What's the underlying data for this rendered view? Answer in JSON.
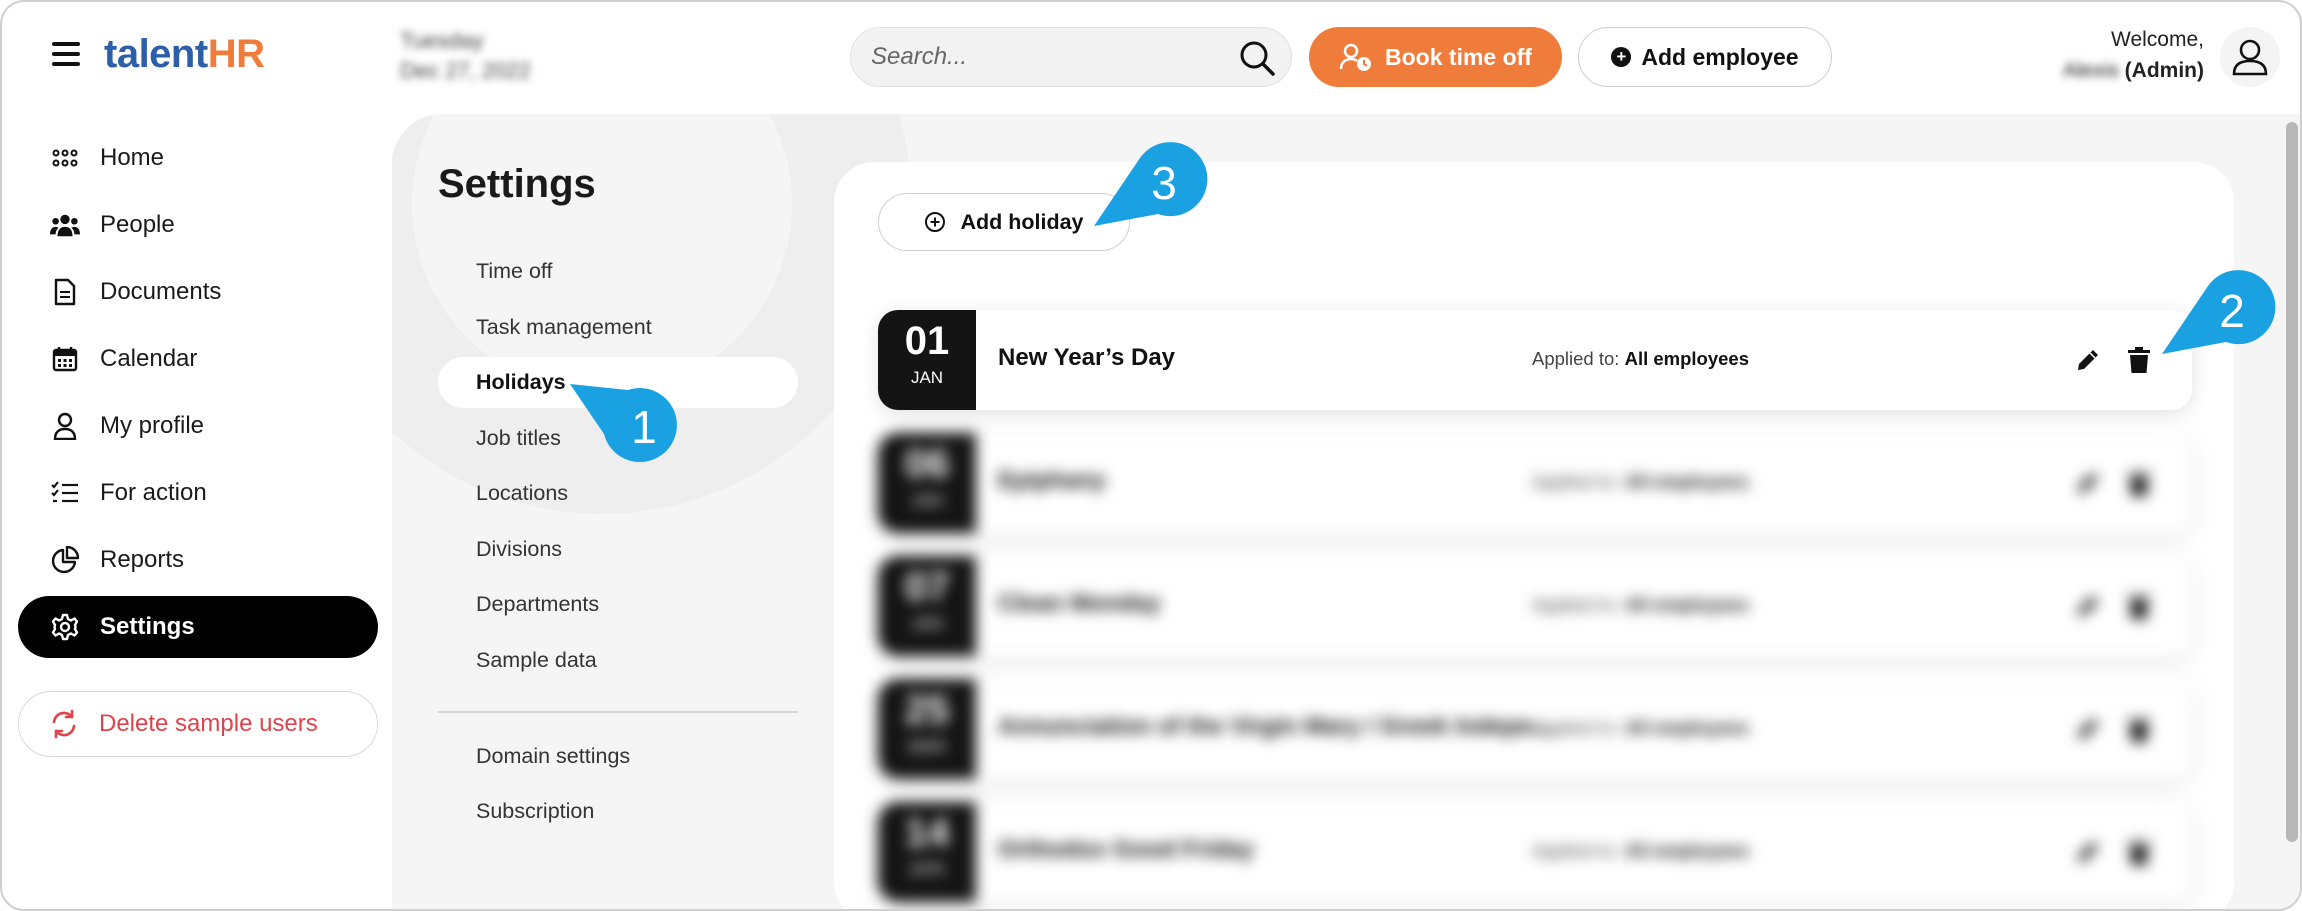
{
  "app": {
    "logo_part1": "talent",
    "logo_part2": "HR",
    "date_line1": "Tuesday",
    "date_line2": "Dec 27, 2022"
  },
  "header": {
    "search_placeholder": "Search...",
    "book_time_off": "Book time off",
    "add_employee": "Add employee",
    "welcome": "Welcome,",
    "user_name": "Alexis",
    "user_role": "(Admin)"
  },
  "sidebar": {
    "items": [
      {
        "label": "Home",
        "icon": "grid-icon"
      },
      {
        "label": "People",
        "icon": "people-icon"
      },
      {
        "label": "Documents",
        "icon": "document-icon"
      },
      {
        "label": "Calendar",
        "icon": "calendar-icon"
      },
      {
        "label": "My profile",
        "icon": "person-icon"
      },
      {
        "label": "For action",
        "icon": "checklist-icon"
      },
      {
        "label": "Reports",
        "icon": "pie-chart-icon"
      },
      {
        "label": "Settings",
        "icon": "gear-icon",
        "active": true
      }
    ],
    "delete_sample_users": "Delete sample users"
  },
  "settings": {
    "title": "Settings",
    "menu": [
      "Time off",
      "Task management",
      "Holidays",
      "Job titles",
      "Locations",
      "Divisions",
      "Departments",
      "Sample data"
    ],
    "menu_active": "Holidays",
    "menu_secondary": [
      "Domain settings",
      "Subscription"
    ]
  },
  "holidays": {
    "add_label": "Add holiday",
    "applied_label": "Applied to:",
    "rows": [
      {
        "day": "01",
        "month": "JAN",
        "name": "New Year’s Day",
        "applied_to": "All employees"
      },
      {
        "day": "06",
        "month": "JAN",
        "name": "Epiphany",
        "applied_to": "All employees"
      },
      {
        "day": "07",
        "month": "JAN",
        "name": "Clean Monday",
        "applied_to": "All employees"
      },
      {
        "day": "25",
        "month": "MAR",
        "name": "Annunciation of the Virgin Mary / Greek Independence Day",
        "applied_to": "All employees"
      },
      {
        "day": "14",
        "month": "APR",
        "name": "Orthodox Good Friday",
        "applied_to": "All employees"
      }
    ]
  },
  "callouts": [
    "1",
    "2",
    "3"
  ],
  "colors": {
    "accent": "#f07c3c",
    "brand_blue": "#2d5fa8",
    "callout": "#1aa1e2",
    "danger": "#e0434b"
  }
}
